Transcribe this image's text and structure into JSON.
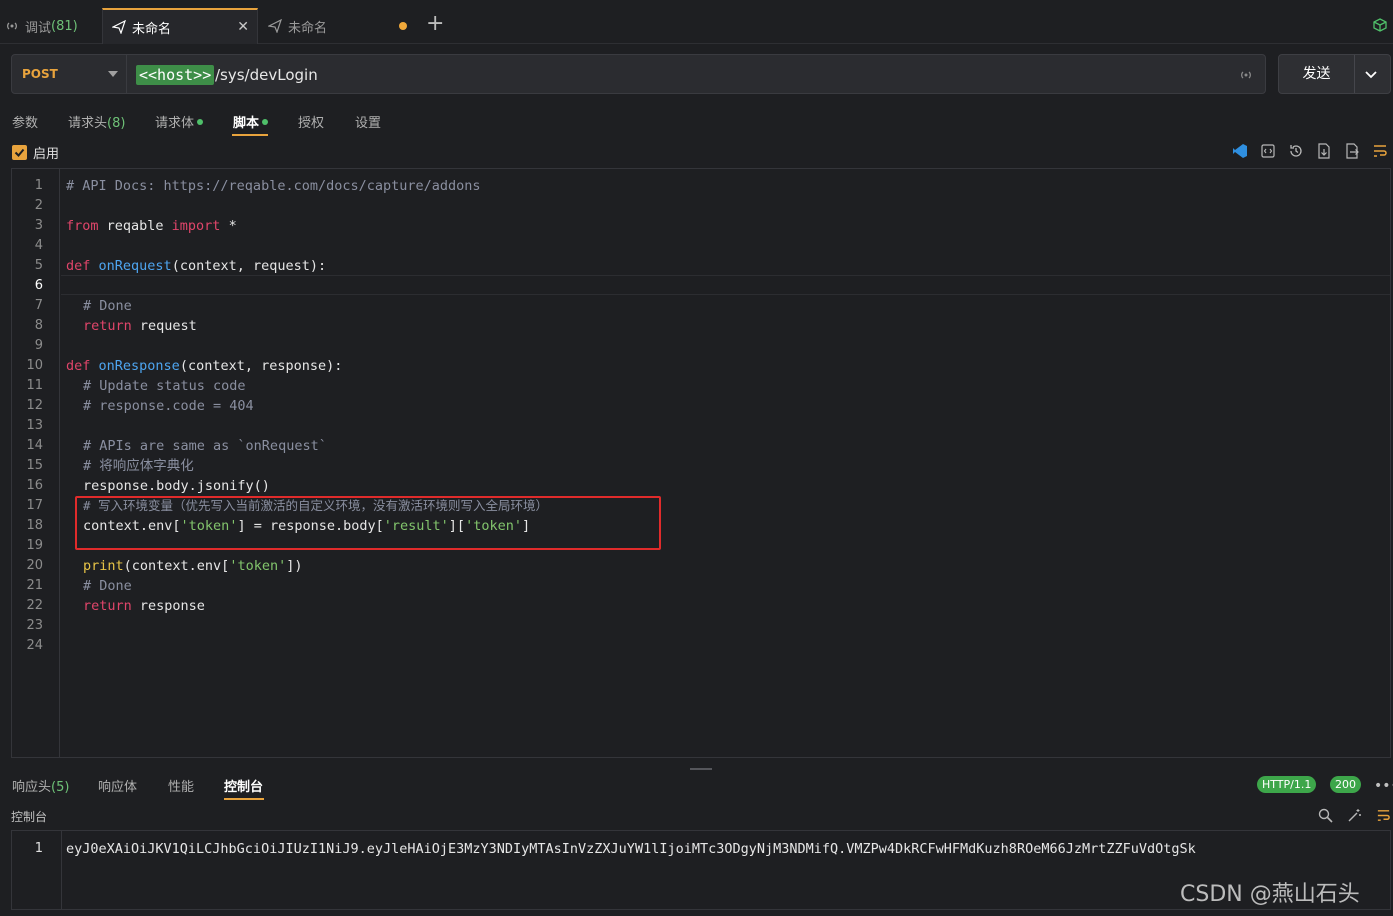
{
  "tabs": [
    {
      "label": "调试",
      "count": "(81)"
    },
    {
      "label": "未命名"
    },
    {
      "label": "未命名"
    }
  ],
  "request": {
    "method": "POST",
    "host_chip": "<<host>>",
    "path": "/sys/devLogin",
    "send_label": "发送"
  },
  "subtabs": [
    {
      "label": "参数"
    },
    {
      "label": "请求头",
      "count": "(8)"
    },
    {
      "label": "请求体"
    },
    {
      "label": "脚本"
    },
    {
      "label": "授权"
    },
    {
      "label": "设置"
    }
  ],
  "enable_label": "启用",
  "editor": {
    "line_numbers": [
      "1",
      "2",
      "3",
      "4",
      "5",
      "6",
      "7",
      "8",
      "9",
      "10",
      "11",
      "12",
      "13",
      "14",
      "15",
      "16",
      "17",
      "18",
      "19",
      "20",
      "21",
      "22",
      "23",
      "24"
    ],
    "current_line": "6"
  },
  "code": {
    "l1": "# API Docs: https://reqable.com/docs/capture/addons",
    "l3_kw1": "from",
    "l3_mod": " reqable ",
    "l3_kw2": "import",
    "l3_rest": " *",
    "l5_kw": "def",
    "l5_fn": "onRequest",
    "l5_rest": "(context, request):",
    "l7": "# Done",
    "l8_kw": "return",
    "l8_rest": " request",
    "l10_kw": "def",
    "l10_fn": "onResponse",
    "l10_rest": "(context, response):",
    "l11": "# Update status code",
    "l12": "# response.code = 404",
    "l14": "# APIs are same as `onRequest`",
    "l15": "# 将响应体字典化",
    "l16": "response.body.jsonify()",
    "l17": "# 写入环境变量（优先写入当前激活的自定义环境，没有激活环境则写入全局环境）",
    "l18_a": "context.env[",
    "l18_s1": "'token'",
    "l18_b": "] = response.body[",
    "l18_s2": "'result'",
    "l18_c": "][",
    "l18_s3": "'token'",
    "l18_d": "]",
    "l20_bi": "print",
    "l20_a": "(context.env[",
    "l20_s": "'token'",
    "l20_b": "])",
    "l21": "# Done",
    "l22_kw": "return",
    "l22_rest": " response"
  },
  "bottom_tabs": [
    {
      "label": "响应头",
      "count": "(5)"
    },
    {
      "label": "响应体"
    },
    {
      "label": "性能"
    },
    {
      "label": "控制台"
    }
  ],
  "badges": {
    "protocol": "HTTP/1.1",
    "status": "200"
  },
  "console": {
    "label": "控制台",
    "line_number": "1",
    "output": "eyJ0eXAiOiJKV1QiLCJhbGciOiJIUzI1NiJ9.eyJleHAiOjE3MzY3NDIyMTAsInVzZXJuYW1lIjoiMTc3ODgyNjM3NDMifQ.VMZPw4DkRCFwHFMdKuzh8ROeM66JzMrtZZFuVdOtgSk"
  },
  "watermark": "CSDN @燕山石头",
  "colors": {
    "accent": "#e8a33d",
    "success": "#3da64a",
    "highlight_box": "#e02b2b"
  }
}
